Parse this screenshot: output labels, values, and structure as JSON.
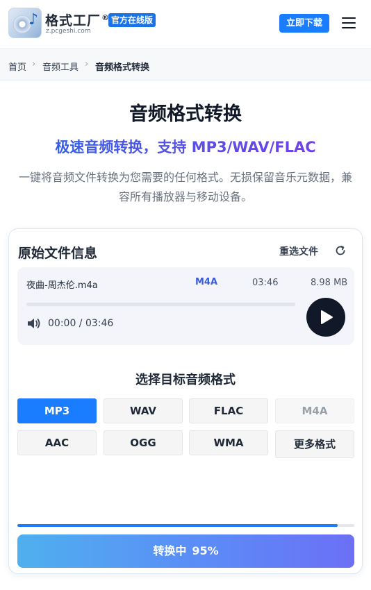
{
  "header": {
    "brand_name": "格式工厂",
    "brand_mark": "®",
    "brand_url": "z.pcgeshi.com",
    "official_badge": "官方在线版",
    "download_label": "立即下载",
    "menu_icon": "hamburger-menu-icon",
    "logo_icon": "format-factory-logo-icon",
    "accent_color": "#1a7cff"
  },
  "breadcrumb": {
    "items": [
      "首页",
      "音频工具",
      "音频格式转换"
    ],
    "separator_icon": "chevron-right-icon"
  },
  "hero": {
    "title": "音频格式转换",
    "subtitle": "极速音频转换，支持 MP3/WAV/FLAC",
    "description": "一键将音频文件转换为您需要的任何格式。无损保留音乐元数据，兼容所有播放器与移动设备。"
  },
  "source_file": {
    "section_title": "原始文件信息",
    "reselect_label": "重选文件",
    "reselect_icon": "refresh-icon",
    "name": "夜曲-周杰伦.m4a",
    "format": "M4A",
    "duration": "03:46",
    "size": "8.98 MB",
    "time_display": "00:00 / 03:46",
    "playback_position": 0,
    "volume_icon": "speaker-icon",
    "play_icon": "play-icon"
  },
  "target_format": {
    "heading": "选择目标音频格式",
    "options": [
      {
        "label": "MP3",
        "state": "selected"
      },
      {
        "label": "WAV",
        "state": "normal"
      },
      {
        "label": "FLAC",
        "state": "normal"
      },
      {
        "label": "M4A",
        "state": "disabled"
      },
      {
        "label": "AAC",
        "state": "normal"
      },
      {
        "label": "OGG",
        "state": "normal"
      },
      {
        "label": "WMA",
        "state": "normal"
      },
      {
        "label": "更多格式",
        "state": "normal"
      }
    ]
  },
  "conversion": {
    "status_label": "转换中",
    "progress_label": "95%",
    "progress_fraction": 0.95,
    "button_gradient": [
      "#4fb0ee",
      "#6c70f6"
    ]
  }
}
